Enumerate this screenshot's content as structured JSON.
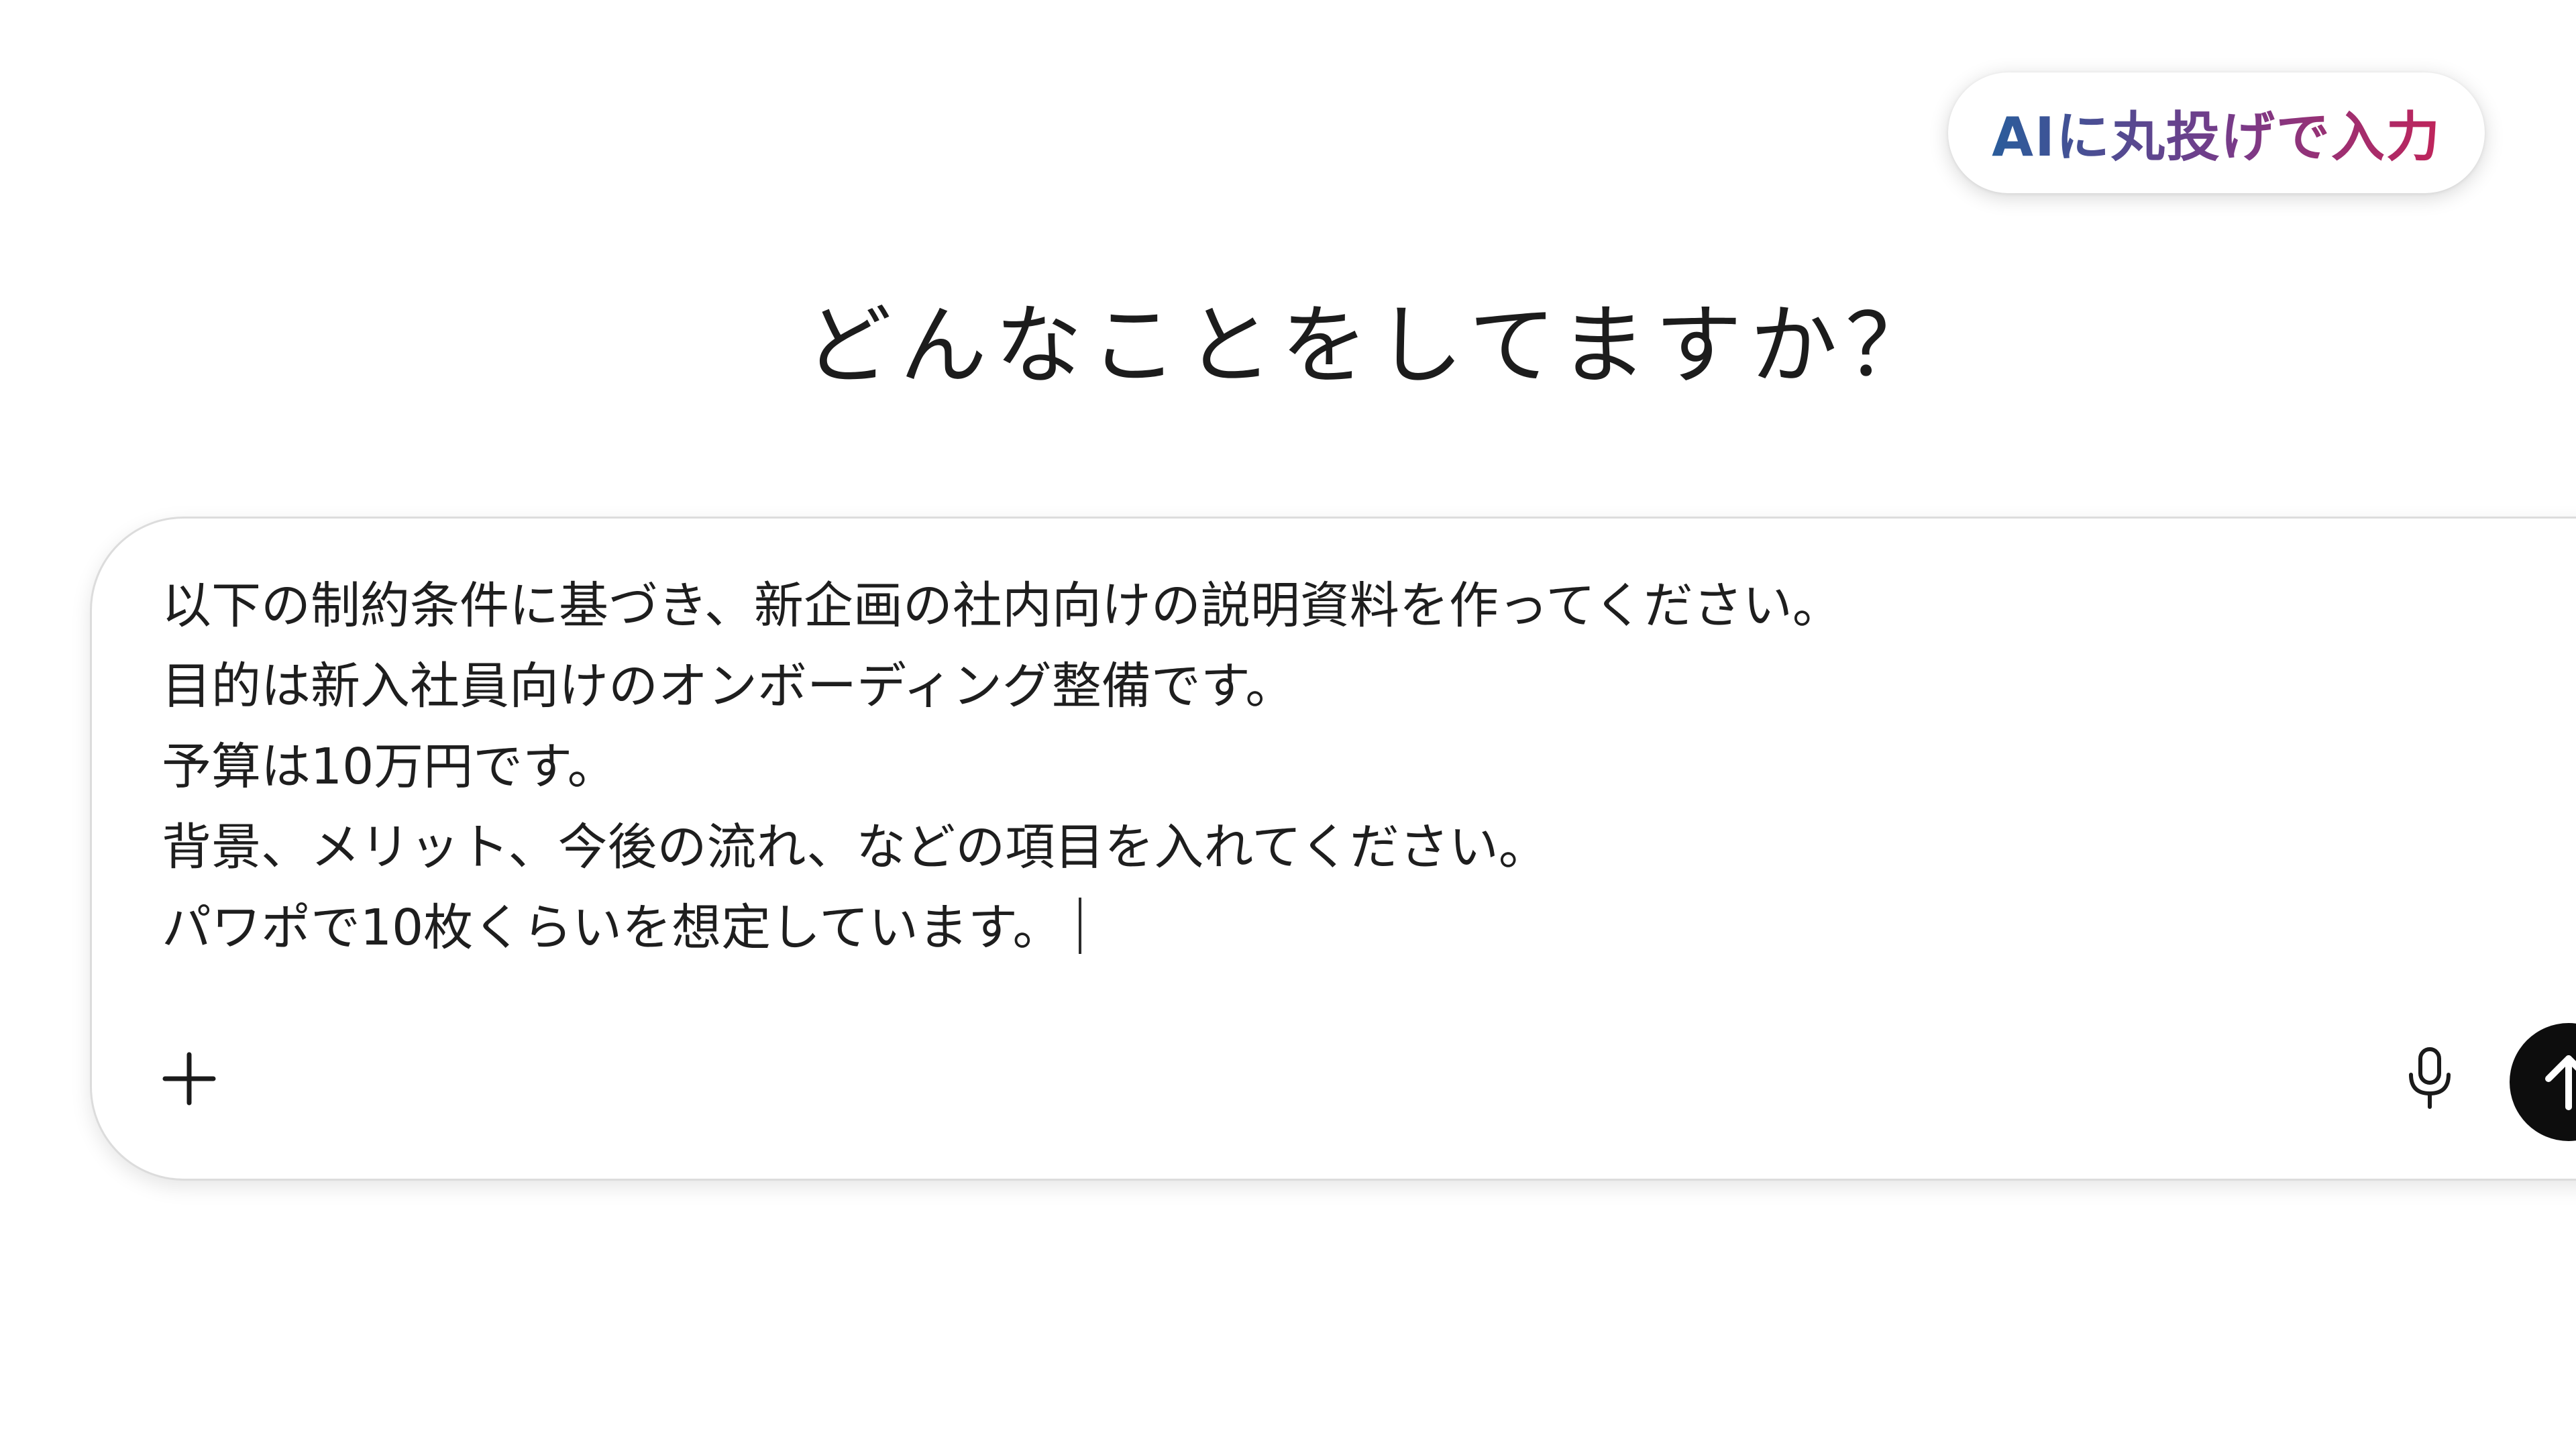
{
  "badge": {
    "label": "AIに丸投げで入力"
  },
  "headline": "どんなことをしてますか？",
  "composer": {
    "prompt_lines": [
      "以下の制約条件に基づき、新企画の社内向けの説明資料を作ってください。",
      "目的は新入社員向けのオンボーディング整備です。",
      "予算は10万円です。",
      "背景、メリット、今後の流れ、などの項目を入れてください。",
      "パワポで10枚くらいを想定しています。"
    ],
    "icons": {
      "add": "plus-icon",
      "voice": "microphone-icon",
      "send": "arrow-up-icon"
    }
  },
  "colors": {
    "badge_gradient_start": "#2a5c9b",
    "badge_gradient_mid": "#7a3a88",
    "badge_gradient_end": "#c0245a",
    "send_button": "#0d0d0d",
    "text": "#1e1e1e"
  }
}
